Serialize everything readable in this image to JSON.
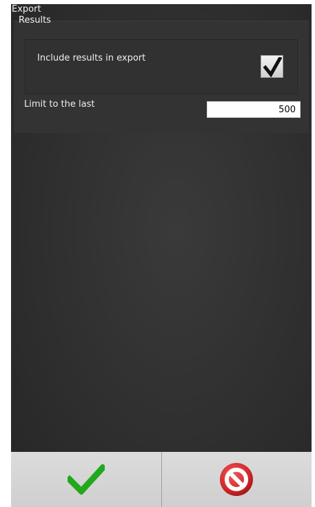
{
  "window": {
    "title": "Export"
  },
  "results_group": {
    "label": "Results",
    "include_option": {
      "label": "Include results in export",
      "checked": true
    },
    "limit": {
      "label": "Limit to the last",
      "value": "500"
    }
  },
  "actions": {
    "ok_icon": "green-check-icon",
    "cancel_icon": "red-cancel-icon",
    "colors": {
      "ok": "#22a81d",
      "cancel": "#d2272a"
    }
  }
}
